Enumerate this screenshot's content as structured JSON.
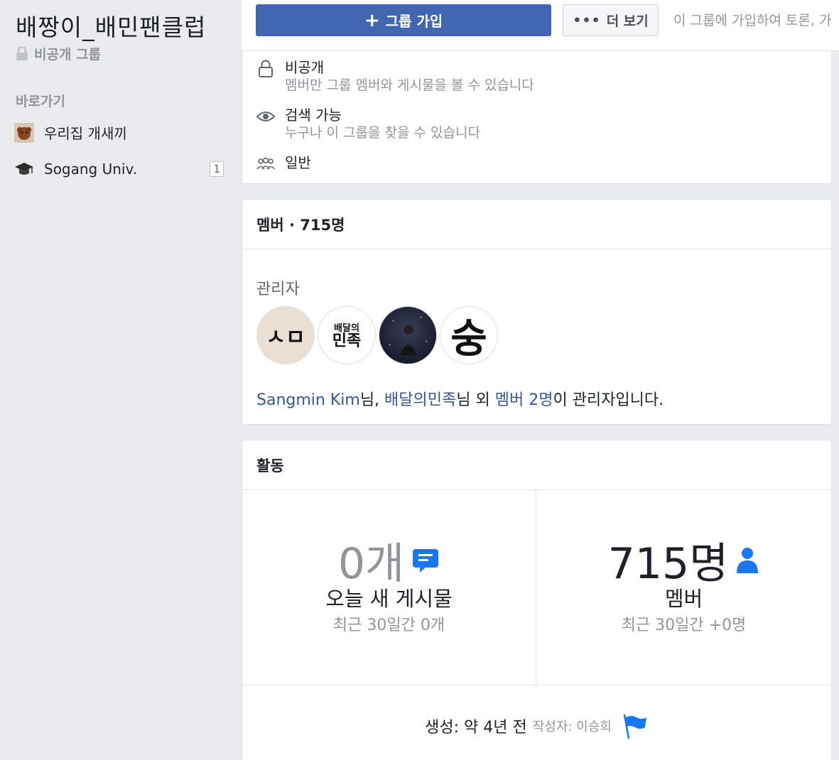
{
  "sidebar": {
    "group_name": "배짱이_배민팬클럽",
    "privacy": "비공개 그룹",
    "shortcuts_header": "바로가기",
    "shortcuts": [
      {
        "label": "우리집 개새끼",
        "icon": "dog-photo-icon"
      },
      {
        "label": "Sogang Univ.",
        "icon": "graduation-cap-icon",
        "count": "1"
      }
    ]
  },
  "topbar": {
    "join_label": "그룹 가입",
    "more_label": "더 보기",
    "join_hint": "이 그룹에 가입하여 토론, 가"
  },
  "about": {
    "privacy_title": "비공개",
    "privacy_desc": "멤버만 그룹 멤버와 게시물을 볼 수 있습니다",
    "visibility_title": "검색 가능",
    "visibility_desc": "누구나 이 그룹을 찾을 수 있습니다",
    "type": "일반"
  },
  "members": {
    "header": "멤버 · 715명",
    "admin_label": "관리자",
    "admins": [
      {
        "initials": "ㅅㅁ"
      },
      {
        "text_line1": "배달의",
        "text_line2": "민족"
      },
      {
        "kind": "photo"
      },
      {
        "initials": "숭"
      }
    ],
    "admin_name1": "Sangmin Kim",
    "admin_sep1": "님, ",
    "admin_name2": "배달의민족",
    "admin_sep2": "님 외 ",
    "admin_others": "멤버 2명",
    "admin_suffix": "이 관리자입니다."
  },
  "activity": {
    "header": "활동",
    "posts_today": "0개",
    "posts_label": "오늘 새 게시물",
    "posts_sub": "최근 30일간 0개",
    "members_count": "715명",
    "members_label": "멤버",
    "members_sub": "최근 30일간 +0명",
    "created": "생성: 약 4년 전",
    "created_by": "작성자: 이승희"
  },
  "colors": {
    "primary": "#4267b2",
    "link": "#365899",
    "icon_blue": "#1877f2",
    "muted": "#90949c"
  }
}
